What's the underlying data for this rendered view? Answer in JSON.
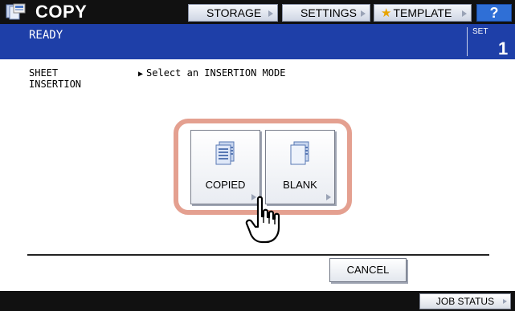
{
  "header": {
    "app_icon": "copy-icon",
    "title": "COPY",
    "buttons": {
      "storage": "STORAGE",
      "settings": "SETTINGS",
      "template": "TEMPLATE",
      "help": "?"
    }
  },
  "status": {
    "state": "READY",
    "set_label": "SET",
    "set_count": "1"
  },
  "content": {
    "section_label": "SHEET\nINSERTION",
    "instruction": "Select an INSERTION MODE",
    "modes": [
      {
        "label": "COPIED",
        "icon": "copied-sheet-icon"
      },
      {
        "label": "BLANK",
        "icon": "blank-sheet-icon"
      }
    ],
    "highlight_color": "#e4a090"
  },
  "footer": {
    "cancel": "CANCEL",
    "job_status": "JOB STATUS"
  },
  "colors": {
    "topbar": "#111111",
    "statusbar": "#1e3fa8",
    "help": "#2f6fd6"
  }
}
